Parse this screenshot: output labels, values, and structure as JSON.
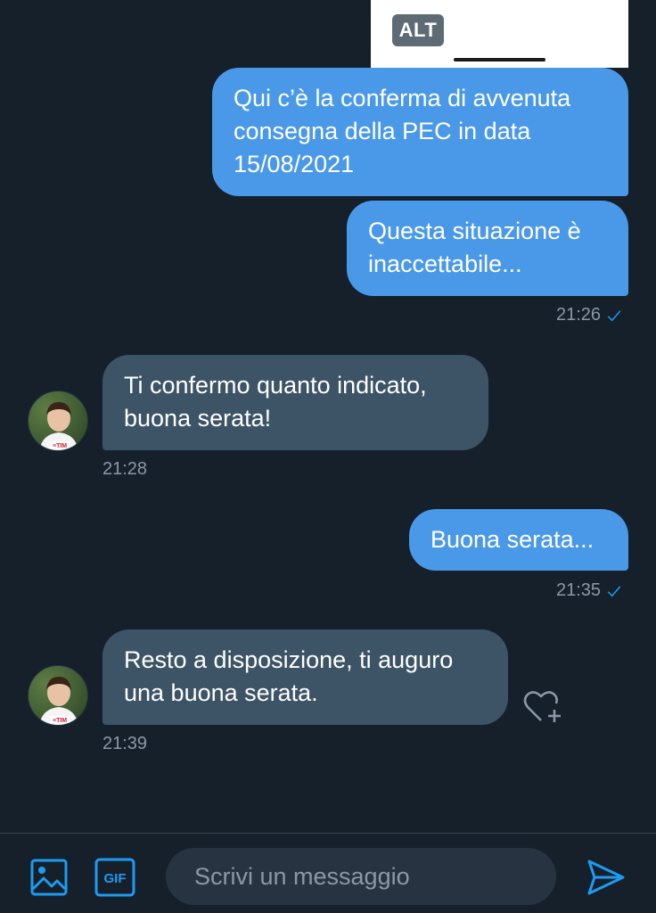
{
  "attachment": {
    "alt_label": "ALT"
  },
  "messages": [
    {
      "lines": [
        "Qui c’è la conferma di avvenuta",
        "consegna della PEC in data",
        "15/08/2021"
      ]
    },
    {
      "lines": [
        "Questa situazione è",
        "inaccettabile..."
      ],
      "time": "21:26"
    },
    {
      "lines": [
        "Ti confermo quanto indicato,",
        "buona serata!"
      ],
      "time": "21:28"
    },
    {
      "lines": [
        "Buona serata..."
      ],
      "time": "21:35"
    },
    {
      "lines": [
        "Resto a disposizione, ti auguro",
        "una buona serata."
      ],
      "time": "21:39"
    }
  ],
  "composer": {
    "placeholder": "Scrivi un messaggio",
    "gif_label": "GIF"
  },
  "colors": {
    "background": "#15202b",
    "outgoing": "#4a99e9",
    "incoming": "#3d5466",
    "accent": "#1d9bf0",
    "muted": "#8b98a5"
  },
  "icons": [
    "image-icon",
    "gif-icon",
    "send-icon",
    "heart-add-icon",
    "check-icon"
  ]
}
